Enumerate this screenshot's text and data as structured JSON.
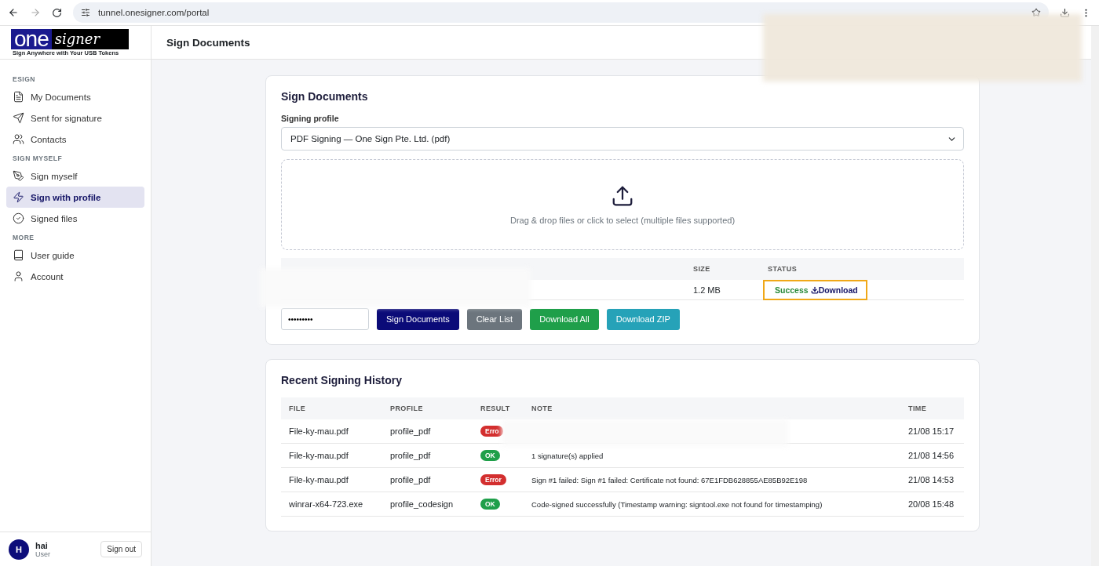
{
  "browser": {
    "url": "tunnel.onesigner.com/portal"
  },
  "sidebar": {
    "logo": {
      "main": "one",
      "script": "signer",
      "tagline": "Sign Anywhere with Your USB Tokens"
    },
    "sections": [
      {
        "title": "ESIGN",
        "items": [
          {
            "label": "My Documents",
            "selected": false
          },
          {
            "label": "Sent for signature",
            "selected": false
          },
          {
            "label": "Contacts",
            "selected": false
          }
        ]
      },
      {
        "title": "SIGN MYSELF",
        "items": [
          {
            "label": "Sign myself",
            "selected": false
          },
          {
            "label": "Sign with profile",
            "selected": true
          },
          {
            "label": "Signed files",
            "selected": false
          }
        ]
      },
      {
        "title": "MORE",
        "items": [
          {
            "label": "User guide",
            "selected": false
          },
          {
            "label": "Account",
            "selected": false
          }
        ]
      }
    ],
    "user": {
      "initial": "H",
      "name": "hai",
      "role": "User"
    },
    "sign_out": "Sign out"
  },
  "header": {
    "title": "Sign Documents"
  },
  "sign_card": {
    "title": "Sign Documents",
    "profile_label": "Signing profile",
    "profile_value": "PDF Signing — One Sign Pte. Ltd. (pdf)",
    "dropzone": "Drag & drop files or click to select (multiple files supported)",
    "columns": [
      "SIZE",
      "STATUS"
    ],
    "rows": [
      {
        "size": "1.2 MB",
        "status": "Success",
        "link": "Download",
        "highlighted": true
      }
    ],
    "password": "•••••••••",
    "buttons": [
      {
        "label": "Sign Documents",
        "kind": "primary"
      },
      {
        "label": "Clear List",
        "kind": "secondary"
      },
      {
        "label": "Download All",
        "kind": "success"
      },
      {
        "label": "Download ZIP",
        "kind": "info"
      }
    ]
  },
  "history": {
    "title": "Recent Signing History",
    "columns": [
      "FILE",
      "PROFILE",
      "RESULT",
      "NOTE",
      "TIME"
    ],
    "rows": [
      {
        "file": "File-ky-mau.pdf",
        "profile": "profile_pdf",
        "result": {
          "label": "Erro",
          "kind": "error"
        },
        "time": "21/08 15:17"
      },
      {
        "file": "File-ky-mau.pdf",
        "profile": "profile_pdf",
        "result": {
          "label": "OK",
          "kind": "ok"
        },
        "note": "1 signature(s) applied",
        "time": "21/08 14:56"
      },
      {
        "file": "File-ky-mau.pdf",
        "profile": "profile_pdf",
        "result": {
          "label": "Error",
          "kind": "error"
        },
        "note": "Sign #1 failed: Sign #1 failed: Certificate not found: 67E1FDB628855AE85B92E198",
        "time": "21/08 14:53"
      },
      {
        "file": "winrar-x64-723.exe",
        "profile": "profile_codesign",
        "result": {
          "label": "OK",
          "kind": "ok"
        },
        "note": "Code-signed successfully (Timestamp warning: signtool.exe not found for timestamping)",
        "time": "20/08 15:48"
      }
    ]
  }
}
